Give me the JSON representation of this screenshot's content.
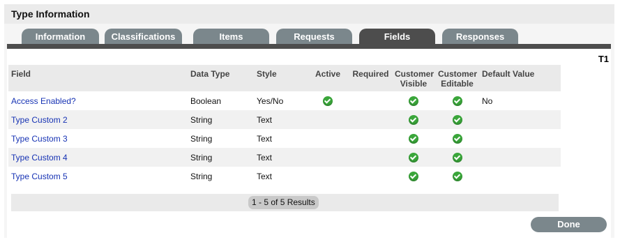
{
  "header": {
    "title": "Type Information"
  },
  "tabs": [
    {
      "label": "Information",
      "active": false
    },
    {
      "label": "Classifications",
      "active": false
    },
    {
      "label": "Items",
      "active": false
    },
    {
      "label": "Requests",
      "active": false
    },
    {
      "label": "Fields",
      "active": true
    },
    {
      "label": "Responses",
      "active": false
    }
  ],
  "type_code": "T1",
  "table": {
    "columns": [
      "Field",
      "Data Type",
      "Style",
      "Active",
      "Required",
      "Customer Visible",
      "Customer Editable",
      "Default Value"
    ],
    "rows": [
      {
        "field": "Access Enabled?",
        "data_type": "Boolean",
        "style": "Yes/No",
        "active": true,
        "required": false,
        "customer_visible": true,
        "customer_editable": true,
        "default_value": "No"
      },
      {
        "field": "Type Custom 2",
        "data_type": "String",
        "style": "Text",
        "active": false,
        "required": false,
        "customer_visible": true,
        "customer_editable": true,
        "default_value": ""
      },
      {
        "field": "Type Custom 3",
        "data_type": "String",
        "style": "Text",
        "active": false,
        "required": false,
        "customer_visible": true,
        "customer_editable": true,
        "default_value": ""
      },
      {
        "field": "Type Custom 4",
        "data_type": "String",
        "style": "Text",
        "active": false,
        "required": false,
        "customer_visible": true,
        "customer_editable": true,
        "default_value": ""
      },
      {
        "field": "Type Custom 5",
        "data_type": "String",
        "style": "Text",
        "active": false,
        "required": false,
        "customer_visible": true,
        "customer_editable": true,
        "default_value": ""
      }
    ]
  },
  "pager": {
    "text": "1 - 5 of 5 Results"
  },
  "done_label": "Done",
  "colors": {
    "tab": "#7b878c",
    "tab_active": "#4d4d4d",
    "link": "#1733b4",
    "check": "#3aa63a"
  },
  "icons": {
    "checkmark": "check-circle-icon"
  }
}
